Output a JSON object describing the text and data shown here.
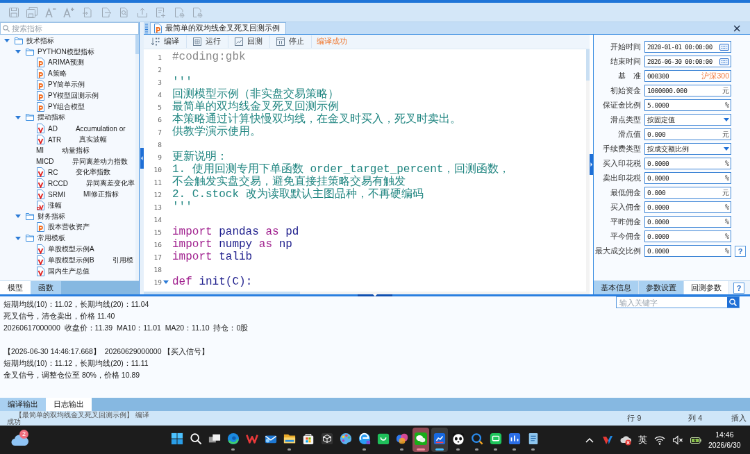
{
  "toolbar": [
    {
      "kind": "save",
      "disabled": true
    },
    {
      "kind": "save-all",
      "disabled": true
    },
    {
      "kind": "font-smaller",
      "disabled": true
    },
    {
      "kind": "font-larger",
      "disabled": true
    },
    {
      "kind": "import",
      "disabled": true
    },
    {
      "kind": "export",
      "disabled": true
    },
    {
      "kind": "find",
      "disabled": true
    },
    {
      "kind": "tray",
      "disabled": true
    },
    {
      "kind": "doc-plus",
      "disabled": true
    },
    {
      "kind": "doc-gear",
      "disabled": true
    },
    {
      "kind": "doc-gear",
      "disabled": true
    }
  ],
  "sidebar": {
    "search": {
      "placeholder": "搜索指标"
    },
    "tree": [
      {
        "kind": "folder",
        "label": "技术指标",
        "expanded": true,
        "children": [
          {
            "kind": "folder",
            "label": "PYTHON模型指标",
            "expanded": true,
            "children": [
              {
                "kind": "python",
                "label": "ARIMA预测"
              },
              {
                "kind": "python",
                "label": "A策略"
              },
              {
                "kind": "python",
                "label": "PY简单示例"
              },
              {
                "kind": "python",
                "label": "PY模型回测示例"
              },
              {
                "kind": "python",
                "label": "PY组合模型"
              }
            ]
          },
          {
            "kind": "folder",
            "label": "摆动指标",
            "expanded": true,
            "children": [
              {
                "kind": "formula",
                "label": "AD",
                "description": "Accumulation or"
              },
              {
                "kind": "formula",
                "label": "ATR",
                "description": "真实波幅"
              },
              {
                "kind": "plain",
                "label": "MI",
                "description": "动量指标"
              },
              {
                "kind": "plain",
                "label": "MICD",
                "description": "异同离差动力指数"
              },
              {
                "kind": "formula",
                "label": "RC",
                "description": "变化率指数"
              },
              {
                "kind": "formula",
                "label": "RCCD",
                "description": "异同离差变化率"
              },
              {
                "kind": "formula",
                "label": "SRMI",
                "description": "MI修正指标"
              },
              {
                "kind": "formula-lock",
                "label": "涨幅"
              }
            ]
          },
          {
            "kind": "folder",
            "label": "财务指标",
            "expanded": true,
            "children": [
              {
                "kind": "python",
                "label": "股本营收资产"
              }
            ]
          },
          {
            "kind": "folder",
            "label": "常用模板",
            "expanded": true,
            "children": [
              {
                "kind": "formula",
                "label": "单股模型示例A"
              },
              {
                "kind": "formula",
                "label": "单股模型示例B",
                "description": "引用模"
              },
              {
                "kind": "formula",
                "label": "国内生产总值"
              }
            ]
          }
        ]
      }
    ],
    "tabs": [
      {
        "label": "模型",
        "selected": true
      },
      {
        "label": "函数",
        "selected": false
      }
    ]
  },
  "editor": {
    "tab": {
      "label": "最简单的双均线金叉死叉回测示例",
      "selected": true
    },
    "close": "×",
    "buttons": [
      {
        "kind": "compile",
        "label": "编译"
      },
      {
        "kind": "run",
        "label": "运行"
      },
      {
        "kind": "backtest",
        "label": "回测"
      },
      {
        "kind": "stop",
        "label": "停止"
      }
    ],
    "status": "编译成功",
    "lines": [
      {
        "number": "1",
        "tokens": [
          {
            "kind": "comment",
            "text": "#coding:gbk"
          }
        ]
      },
      {
        "number": "2"
      },
      {
        "number": "3",
        "tokens": [
          {
            "kind": "string",
            "text": "'''"
          }
        ]
      },
      {
        "number": "4",
        "tokens": [
          {
            "kind": "string",
            "text": "回测模型示例（非实盘交易策略）"
          }
        ]
      },
      {
        "number": "5",
        "tokens": [
          {
            "kind": "string",
            "text": "最简单的双均线金叉死叉回测示例"
          }
        ]
      },
      {
        "number": "6",
        "tokens": [
          {
            "kind": "string",
            "text": "本策略通过计算快慢双均线，在金叉时买入，死叉时卖出。"
          }
        ]
      },
      {
        "number": "7",
        "tokens": [
          {
            "kind": "string",
            "text": "供教学演示使用。"
          }
        ]
      },
      {
        "number": "8"
      },
      {
        "number": "9",
        "tokens": [
          {
            "kind": "string",
            "text": "更新说明："
          }
        ]
      },
      {
        "number": "10",
        "tokens": [
          {
            "kind": "string",
            "text": "1. 使用回测专用下单函数 order_target_percent，回测函数，"
          }
        ]
      },
      {
        "number": "11",
        "tokens": [
          {
            "kind": "string",
            "text": "不会触发实盘交易，避免直接挂策略交易有触发"
          }
        ]
      },
      {
        "number": "12",
        "tokens": [
          {
            "kind": "string",
            "text": "2. C.stock 改为读取默认主图品种，不再硬编码"
          }
        ]
      },
      {
        "number": "13",
        "tokens": [
          {
            "kind": "string",
            "text": "'''"
          }
        ]
      },
      {
        "number": "14"
      },
      {
        "number": "15",
        "tokens": [
          {
            "kind": "keyword",
            "text": "import"
          },
          {
            "kind": "name",
            "text": " pandas "
          },
          {
            "kind": "keyword",
            "text": "as"
          },
          {
            "kind": "name",
            "text": " pd"
          }
        ]
      },
      {
        "number": "16",
        "tokens": [
          {
            "kind": "keyword",
            "text": "import"
          },
          {
            "kind": "name",
            "text": " numpy "
          },
          {
            "kind": "keyword",
            "text": "as"
          },
          {
            "kind": "name",
            "text": " np"
          }
        ]
      },
      {
        "number": "17",
        "tokens": [
          {
            "kind": "keyword",
            "text": "import"
          },
          {
            "kind": "name",
            "text": " talib"
          }
        ]
      },
      {
        "number": "18"
      },
      {
        "number": "19",
        "expanded": true,
        "tokens": [
          {
            "kind": "keyword",
            "text": "def"
          },
          {
            "kind": "name",
            "text": " init(C):"
          }
        ]
      }
    ]
  },
  "backtest_params": {
    "fields": [
      {
        "label": "开始时间",
        "kind": "datetime",
        "value": "2020-01-01 00:00:00"
      },
      {
        "label": "结束时间",
        "kind": "datetime",
        "value": "2026-06-30 00:00:00"
      },
      {
        "label": "基　准",
        "kind": "benchmark",
        "value": "000300",
        "suffix": "沪深300"
      },
      {
        "label": "初始资金",
        "kind": "number",
        "value": "1000000.000",
        "unit": "元"
      },
      {
        "label": "保证金比例",
        "kind": "number",
        "value": "5.0000",
        "unit": "%"
      },
      {
        "label": "滑点类型",
        "kind": "dropdown",
        "value": "按固定值"
      },
      {
        "label": "滑点值",
        "kind": "number",
        "value": "0.000",
        "unit": "元"
      },
      {
        "label": "手续费类型",
        "kind": "dropdown",
        "value": "按成交额比例"
      },
      {
        "label": "买入印花税",
        "kind": "number",
        "value": "0.0000",
        "unit": "%"
      },
      {
        "label": "卖出印花税",
        "kind": "number",
        "value": "0.0000",
        "unit": "%"
      },
      {
        "label": "最低佣金",
        "kind": "number",
        "value": "0.000",
        "unit": "元"
      },
      {
        "label": "买入佣金",
        "kind": "number",
        "value": "0.0000",
        "unit": "%"
      },
      {
        "label": "平昨佣金",
        "kind": "number",
        "value": "0.0000",
        "unit": "%"
      },
      {
        "label": "平今佣金",
        "kind": "number",
        "value": "0.0000",
        "unit": "%"
      },
      {
        "label": "最大成交比例",
        "kind": "number",
        "value": "0.0000",
        "unit": "%",
        "help": "?"
      }
    ],
    "tabs": [
      {
        "label": "基本信息",
        "selected": false
      },
      {
        "label": "参数设置",
        "selected": false
      },
      {
        "label": "回测参数",
        "selected": true
      }
    ],
    "help": "?"
  },
  "log": {
    "search": {
      "placeholder": "输入关键字"
    },
    "blocks": [
      {
        "lines": [
          "短期均线(10)：11.02，长期均线(20)：11.04",
          "死叉信号，清仓卖出，价格 11.40",
          "20260617000000  收盘价：11.39  MA10：11.01  MA20：11.10  持仓：0股"
        ]
      },
      {
        "lines": [
          "【2026-06-30 14:46:17.668】  20260629000000 【买入信号】",
          "短期均线(10)：11.12，长期均线(20)：11.11",
          "金叉信号，调整仓位至 80%，价格 10.89"
        ]
      }
    ]
  },
  "output_tabs": [
    {
      "label": "编译输出",
      "selected": false
    },
    {
      "label": "日志输出",
      "selected": true
    }
  ],
  "compile_output": [
    "【最简单的双均线金叉死叉回测示例】 编译",
    "成功"
  ],
  "status_bar": {
    "line": "行 9",
    "column": "列 4",
    "mode": "插入"
  },
  "taskbar": {
    "weather_badge": "2",
    "apps": [
      {
        "kind": "start",
        "running": false,
        "focused": false,
        "flashing": false
      },
      {
        "kind": "search",
        "running": false,
        "focused": false,
        "flashing": false
      },
      {
        "kind": "task-view",
        "running": false,
        "focused": false,
        "flashing": false
      },
      {
        "kind": "browser",
        "running": true,
        "focused": false,
        "flashing": false
      },
      {
        "kind": "w-logo",
        "running": false,
        "focused": false,
        "flashing": false
      },
      {
        "kind": "mail",
        "running": false,
        "focused": false,
        "flashing": false
      },
      {
        "kind": "folder",
        "running": true,
        "focused": false,
        "flashing": false
      },
      {
        "kind": "store",
        "running": false,
        "focused": false,
        "flashing": false
      },
      {
        "kind": "cube",
        "running": false,
        "focused": false,
        "flashing": false
      },
      {
        "kind": "palette",
        "running": false,
        "focused": false,
        "flashing": false
      },
      {
        "kind": "browser-alt",
        "running": true,
        "focused": false,
        "flashing": false
      },
      {
        "kind": "bag",
        "running": false,
        "focused": false,
        "flashing": false
      },
      {
        "kind": "swirl",
        "running": true,
        "focused": false,
        "flashing": false
      },
      {
        "kind": "chat",
        "running": true,
        "focused": false,
        "flashing": true
      },
      {
        "kind": "stock",
        "running": true,
        "focused": true,
        "flashing": false
      },
      {
        "kind": "panda",
        "running": true,
        "focused": false,
        "flashing": false
      },
      {
        "kind": "chat-search",
        "running": true,
        "focused": false,
        "flashing": false
      },
      {
        "kind": "message",
        "running": true,
        "focused": false,
        "flashing": false
      },
      {
        "kind": "stock-alt",
        "running": true,
        "focused": false,
        "flashing": false
      },
      {
        "kind": "notes",
        "running": true,
        "focused": false,
        "flashing": false
      }
    ],
    "tray": {
      "ime": "英",
      "time": "14:46",
      "date": "2026/6/30"
    }
  }
}
